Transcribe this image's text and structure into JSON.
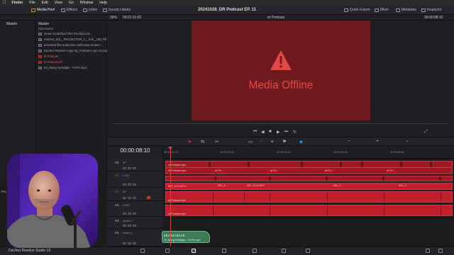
{
  "menubar": {
    "items": [
      "Finder",
      "File",
      "Edit",
      "View",
      "Go",
      "Window",
      "Help"
    ]
  },
  "toolbar": {
    "media_pool": "Media Pool",
    "effects": "Effects",
    "index": "Index",
    "sound_library": "Sound Library",
    "project_title": "20241028_DR Podcast EP. 11",
    "quick_export": "Quick Export",
    "mixer": "Mixer",
    "metadata": "Metadata",
    "inspector": "Inspector"
  },
  "viewer_head": {
    "zoom": "39%",
    "source_timecode": "00:21:11:02",
    "timeline_name": "dr Podcast",
    "record_timecode": "00:00:08:10"
  },
  "master_panel": {
    "title": "Master"
  },
  "clip_panel": {
    "title": "Master",
    "header": "Clip Name",
    "items": [
      {
        "name": "Green Scratched Film Overlay.mov",
        "offline": false
      },
      {
        "name": "ANDS2_115__PROJECTOR_1__Full__Old_Film...",
        "offline": false
      },
      {
        "name": "animated-like-subscribe-notification-button-...",
        "offline": false
      },
      {
        "name": "DaVinci-Resolve-Logo-3g_Podcast Logo v2.png",
        "offline": false
      },
      {
        "name": "dr Podcast",
        "offline": true
      },
      {
        "name": "dr Podcast.aif",
        "offline": true
      },
      {
        "name": "03_Being Nostalgic - FUTK.mp3",
        "offline": false
      }
    ]
  },
  "viewer": {
    "offline_message": "Media Offline"
  },
  "timeline": {
    "timecode": "00:00:08:10",
    "ruler": [
      "00:00:00:00",
      "00:00:02:00",
      "00:00:04:00",
      "00:00:06:00",
      "00:00:08:00"
    ],
    "tracks": [
      {
        "id": "V2",
        "name": "5F"
      },
      {
        "id": "V1",
        "name": "C100"
      },
      {
        "id": "A1",
        "name": "5F"
      },
      {
        "id": "A2",
        "name": "C300"
      },
      {
        "id": "A3",
        "name": "Audio 3"
      },
      {
        "id": "A4",
        "name": "Audio 4"
      }
    ],
    "clip_labels": {
      "podcast": "dr Podcast.mp4",
      "short_podcast": "dr Po...",
      "mvi": "MVI_1213.MP4",
      "short_mvi": "MVI_1...",
      "music": "03_Being Nostalgic - FUTK.mp3"
    }
  },
  "side_panel": {
    "label": "Pro"
  },
  "pagebar": {
    "app_name": "DaVinci Resolve Studio 19"
  },
  "colors": {
    "offline_bg": "#701a1e",
    "offline_text": "#e24848",
    "clip_red": "#bf1e2d",
    "playhead": "#e04040",
    "music_clip": "#3d7a56"
  }
}
